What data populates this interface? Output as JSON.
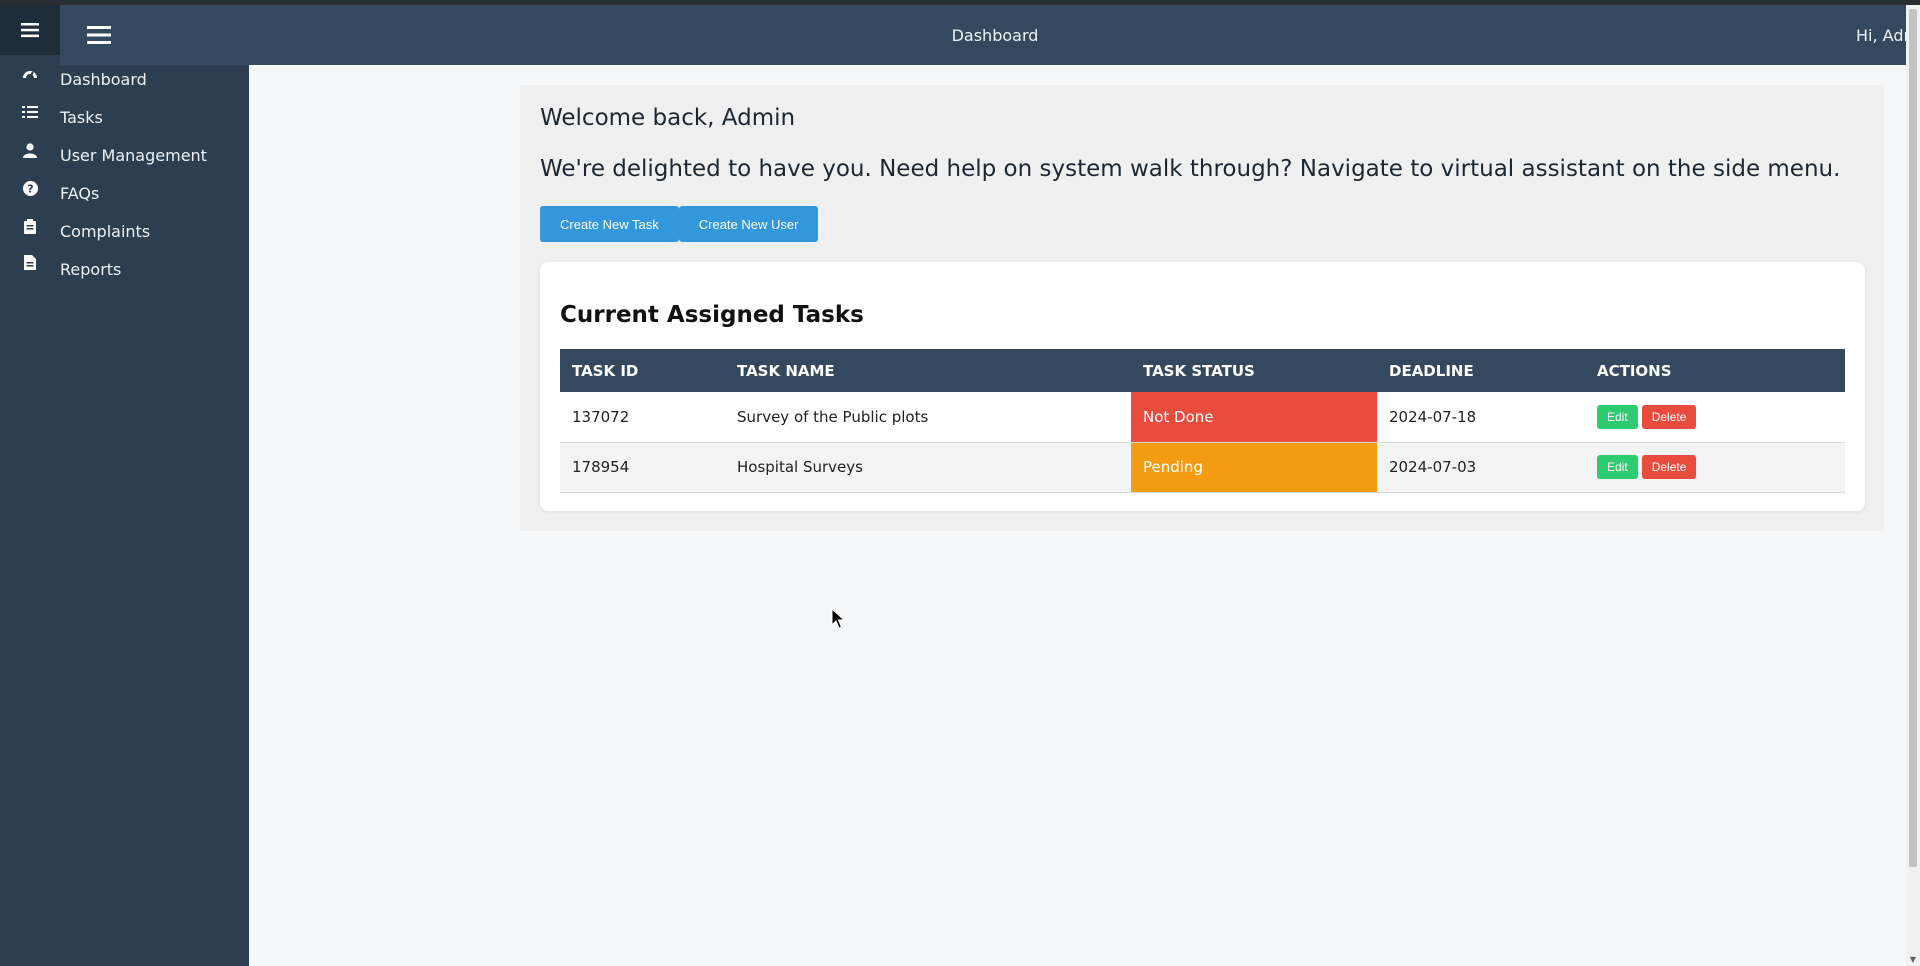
{
  "topbar": {
    "title": "Dashboard",
    "greeting": "Hi, Admin"
  },
  "sidebar": {
    "items": [
      {
        "label": "Dashboard",
        "icon": "dashboard-icon"
      },
      {
        "label": "Tasks",
        "icon": "tasks-list-icon"
      },
      {
        "label": "User Management",
        "icon": "user-icon"
      },
      {
        "label": "FAQs",
        "icon": "question-circle-icon"
      },
      {
        "label": "Complaints",
        "icon": "clipboard-icon"
      },
      {
        "label": "Reports",
        "icon": "file-icon"
      }
    ]
  },
  "welcome": {
    "title": "Welcome back, Admin",
    "message": "We're delighted to have you. Need help on system walk through? Navigate to virtual assistant on the side menu.",
    "create_task_label": "Create New Task",
    "create_user_label": "Create New User"
  },
  "tasks": {
    "heading": "Current Assigned Tasks",
    "columns": [
      "TASK ID",
      "TASK NAME",
      "TASK STATUS",
      "DEADLINE",
      "ACTIONS"
    ],
    "rows": [
      {
        "id": "137072",
        "name": "Survey of the Public plots",
        "status": "Not Done",
        "deadline": "2024-07-18",
        "edit": "Edit",
        "delete": "Delete"
      },
      {
        "id": "178954",
        "name": "Hospital Surveys",
        "status": "Pending",
        "deadline": "2024-07-03",
        "edit": "Edit",
        "delete": "Delete"
      }
    ]
  },
  "colors": {
    "sidebar": "#2c3e50",
    "topbar": "#34495e",
    "primary_button": "#3398db",
    "status_not_done": "#e74c3c",
    "status_pending": "#f39c12",
    "edit_button": "#2ecc71",
    "delete_button": "#e74c3c"
  }
}
